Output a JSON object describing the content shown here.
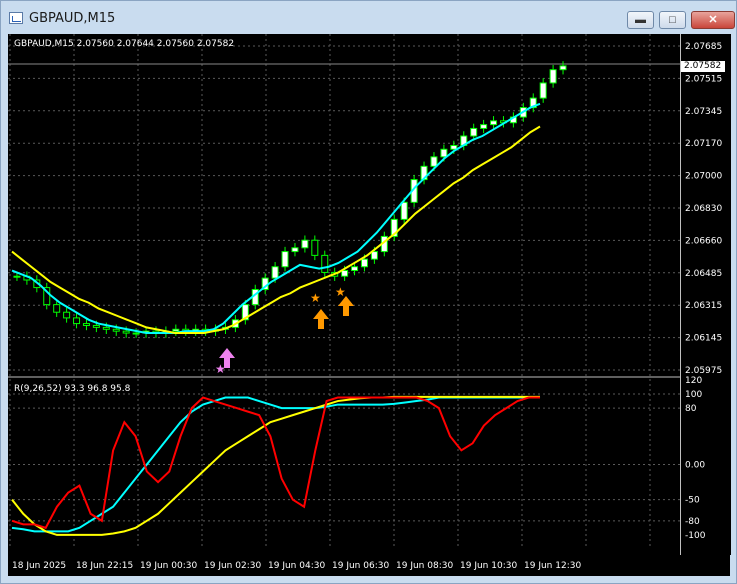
{
  "window": {
    "title": "GBPAUD,M15",
    "buttons": [
      "minimize",
      "maximize",
      "close"
    ]
  },
  "main_chart": {
    "header": "GBPAUD,M15  2.07560 2.07644 2.07560 2.07582",
    "current_price": "2.07582",
    "price_labels": [
      "2.07685",
      "2.07515",
      "2.07345",
      "2.07170",
      "2.07000",
      "2.06830",
      "2.06660",
      "2.06485",
      "2.06315",
      "2.06145",
      "2.05975"
    ]
  },
  "indicator": {
    "header": "R(9,26,52) 93.3 96.8 95.8",
    "levels": [
      "120",
      "100",
      "80",
      "0.00",
      "-50",
      "-80",
      "-100"
    ]
  },
  "time_labels": [
    "18 Jun 2025",
    "18 Jun 22:15",
    "19 Jun 00:30",
    "19 Jun 02:30",
    "19 Jun 04:30",
    "19 Jun 06:30",
    "19 Jun 08:30",
    "19 Jun 10:30",
    "19 Jun 12:30"
  ],
  "colors": {
    "background": "#000000",
    "candle": "#00ff00",
    "ma_fast": "#00ffff",
    "ma_slow": "#ffff00",
    "osc_red": "#ff0000",
    "arrow_up": "#ff9900",
    "arrow_signal": "#ee82ee"
  },
  "chart_data": {
    "type": "line",
    "title": "GBPAUD,M15",
    "price_axis_range": [
      2.05975,
      2.07685
    ],
    "close": [
      2.0647,
      2.0645,
      2.0641,
      2.0632,
      2.0628,
      2.0625,
      2.0622,
      2.0621,
      2.062,
      2.0619,
      2.0618,
      2.0617,
      2.0617,
      2.0618,
      2.0617,
      2.0618,
      2.0619,
      2.0618,
      2.0619,
      2.0618,
      2.0619,
      2.062,
      2.0624,
      2.0632,
      2.064,
      2.0646,
      2.0652,
      2.066,
      2.0662,
      2.0666,
      2.0658,
      2.0649,
      2.0647,
      2.065,
      2.0652,
      2.0656,
      2.066,
      2.0668,
      2.0677,
      2.0686,
      2.0698,
      2.0705,
      2.071,
      2.0714,
      2.0716,
      2.0721,
      2.0725,
      2.0727,
      2.0729,
      2.0728,
      2.0731,
      2.0736,
      2.0741,
      2.0749,
      2.0756,
      2.0758
    ],
    "ma_fast": [
      2.065,
      2.0648,
      2.0646,
      2.0642,
      2.0637,
      2.0633,
      2.063,
      2.0627,
      2.0624,
      2.0622,
      2.0621,
      2.062,
      2.0619,
      2.0618,
      2.0617,
      2.0617,
      2.0617,
      2.0617,
      2.0618,
      2.0618,
      2.0618,
      2.0619,
      2.0622,
      2.0627,
      2.0632,
      2.0636,
      2.064,
      2.0644,
      2.0647,
      2.065,
      2.0653,
      2.0652,
      2.0651,
      2.0652,
      2.0654,
      2.0657,
      2.066,
      2.0665,
      2.067,
      2.0676,
      2.0682,
      2.0688,
      2.0694,
      2.0699,
      2.0704,
      2.0709,
      2.0713,
      2.0716,
      2.0719,
      2.0721,
      2.0724,
      2.0727,
      2.073,
      2.0733,
      2.0736,
      2.0738
    ],
    "ma_slow": [
      2.066,
      2.0656,
      2.0652,
      2.0648,
      2.0644,
      2.0641,
      2.0638,
      2.0635,
      2.0633,
      2.063,
      2.0628,
      2.0626,
      2.0624,
      2.0622,
      2.062,
      2.0619,
      2.0618,
      2.0617,
      2.0617,
      2.0617,
      2.0617,
      2.0618,
      2.0619,
      2.0621,
      2.0624,
      2.0627,
      2.063,
      2.0633,
      2.0636,
      2.0638,
      2.0641,
      2.0643,
      2.0645,
      2.0647,
      2.0649,
      2.0652,
      2.0655,
      2.0658,
      2.0662,
      2.0666,
      2.067,
      2.0675,
      2.068,
      2.0684,
      2.0688,
      2.0692,
      2.0696,
      2.0699,
      2.0703,
      2.0706,
      2.0709,
      2.0712,
      2.0715,
      2.0719,
      2.0723,
      2.0726
    ],
    "osc_red": [
      -80,
      -85,
      -85,
      -90,
      -60,
      -40,
      -30,
      -70,
      -80,
      20,
      60,
      40,
      -10,
      -25,
      -10,
      40,
      80,
      95,
      90,
      85,
      80,
      75,
      70,
      40,
      -20,
      -50,
      -60,
      20,
      90,
      95,
      95,
      95,
      95,
      95,
      95,
      95,
      95,
      90,
      80,
      40,
      20,
      30,
      55,
      70,
      80,
      90,
      95,
      95
    ],
    "osc_cyan": [
      -90,
      -92,
      -95,
      -95,
      -95,
      -95,
      -90,
      -80,
      -70,
      -60,
      -40,
      -20,
      0,
      20,
      40,
      60,
      75,
      85,
      90,
      95,
      95,
      95,
      90,
      85,
      80,
      80,
      80,
      80,
      82,
      85,
      85,
      85,
      85,
      85,
      86,
      88,
      90,
      92,
      95,
      95,
      95,
      95,
      95,
      95,
      95,
      95,
      95,
      96
    ],
    "osc_yellow": [
      -50,
      -70,
      -85,
      -95,
      -100,
      -100,
      -100,
      -100,
      -100,
      -98,
      -95,
      -90,
      -80,
      -70,
      -55,
      -40,
      -25,
      -10,
      5,
      20,
      30,
      40,
      50,
      60,
      65,
      70,
      75,
      80,
      85,
      90,
      92,
      94,
      95,
      95,
      96,
      96,
      96,
      96,
      96,
      96,
      96,
      96,
      96,
      96,
      96,
      96,
      96,
      96
    ]
  }
}
